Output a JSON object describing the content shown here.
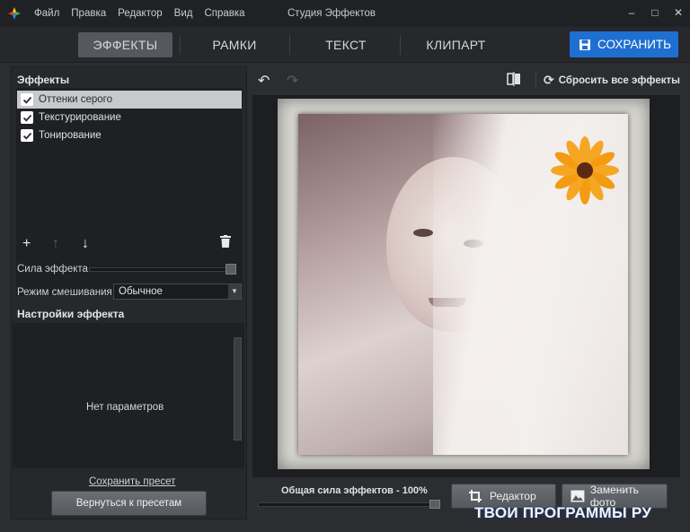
{
  "titlebar": {
    "menu": [
      "Файл",
      "Правка",
      "Редактор",
      "Вид",
      "Справка"
    ],
    "title": "Студия Эффектов",
    "logo_icon": "multicolor-leaf-logo"
  },
  "nav": {
    "tabs": [
      "ЭФФЕКТЫ",
      "РАМКИ",
      "ТЕКСТ",
      "КЛИПАРТ"
    ],
    "active_tab": "ЭФФЕКТЫ",
    "save_label": "СОХРАНИТЬ",
    "save_color": "#1e6fd0"
  },
  "left": {
    "effects_title": "Эффекты",
    "effects": [
      {
        "label": "Оттенки серого",
        "checked": true,
        "selected": true
      },
      {
        "label": "Текстурирование",
        "checked": true,
        "selected": false
      },
      {
        "label": "Тонирование",
        "checked": true,
        "selected": false
      }
    ],
    "strength_label": "Сила эффекта",
    "strength_value": 1.0,
    "blend_label": "Режим смешивания",
    "blend_value": "Обычное",
    "settings_title": "Настройки эффекта",
    "no_params": "Нет параметров",
    "save_preset": "Сохранить пресет",
    "back_button": "Вернуться к пресетам"
  },
  "right": {
    "reset_label": "Сбросить все эффекты",
    "total_strength": "Общая сила эффектов - 100%",
    "total_strength_value": 1.0,
    "editor_button": "Редактор",
    "replace_button": "Заменить фото"
  },
  "watermark": "ТВОИ ПРОГРАММЫ РУ"
}
